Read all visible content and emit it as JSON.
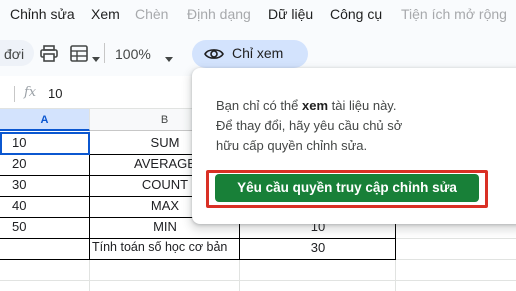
{
  "menu": [
    {
      "label": "Chỉnh sửa",
      "disabled": false
    },
    {
      "label": "Xem",
      "disabled": false
    },
    {
      "label": "Chèn",
      "disabled": true
    },
    {
      "label": "Định dạng",
      "disabled": true
    },
    {
      "label": "Dữ liệu",
      "disabled": false
    },
    {
      "label": "Công cụ",
      "disabled": false
    },
    {
      "label": "Tiện ích mở rộng",
      "disabled": true
    }
  ],
  "toolbar": {
    "partial_left": "đơi",
    "print_icon": "printer-icon",
    "format_icon": "table-format-icon",
    "zoom": "100%",
    "view_only_label": "Chỉ xem",
    "view_only_icon": "eye-icon"
  },
  "formula_bar": {
    "fx": "fx",
    "value": "10"
  },
  "grid": {
    "columns": [
      "A",
      "B"
    ],
    "rows": [
      {
        "a": "10",
        "b": "SUM",
        "c": ""
      },
      {
        "a": "20",
        "b": "AVERAGE",
        "c": ""
      },
      {
        "a": "30",
        "b": "COUNT",
        "c": ""
      },
      {
        "a": "40",
        "b": "MAX",
        "c": ""
      },
      {
        "a": "50",
        "b": "MIN",
        "c": "10"
      },
      {
        "a": "",
        "b": "Tính toán số học cơ bản",
        "c": "30"
      }
    ]
  },
  "popup": {
    "line1_prefix": "Bạn chỉ có thể ",
    "line1_bold": "xem",
    "line1_suffix": " tài liệu này.",
    "line2": "Để thay đổi, hãy yêu cầu chủ sở",
    "line3": "hữu cấp quyền chỉnh sửa.",
    "button": "Yêu cầu quyền truy cập chỉnh sửa"
  },
  "colors": {
    "accent": "#0b57d0",
    "button_green": "#188038",
    "highlight_red": "#d93025",
    "chip_blue": "#d3e3fd"
  }
}
